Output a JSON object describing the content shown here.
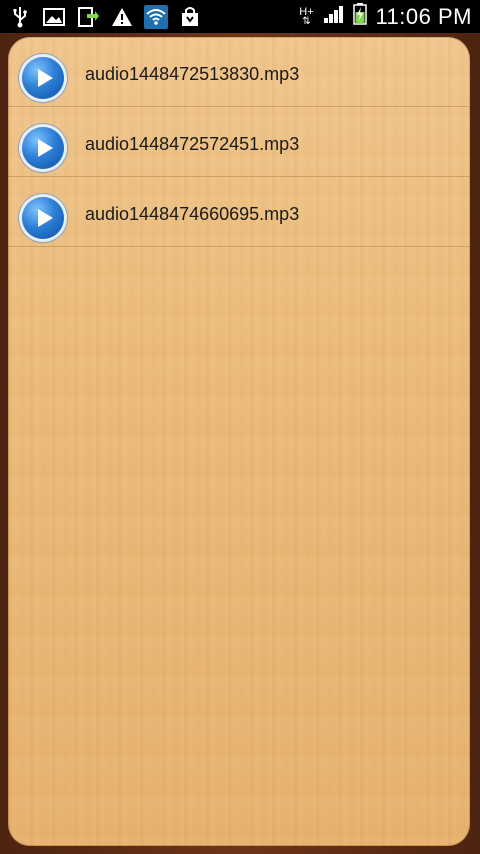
{
  "status_bar": {
    "time": "11:06 PM",
    "network": "H+"
  },
  "recordings": [
    {
      "filename": "audio1448472513830.mp3"
    },
    {
      "filename": "audio1448472572451.mp3"
    },
    {
      "filename": "audio1448474660695.mp3"
    }
  ]
}
